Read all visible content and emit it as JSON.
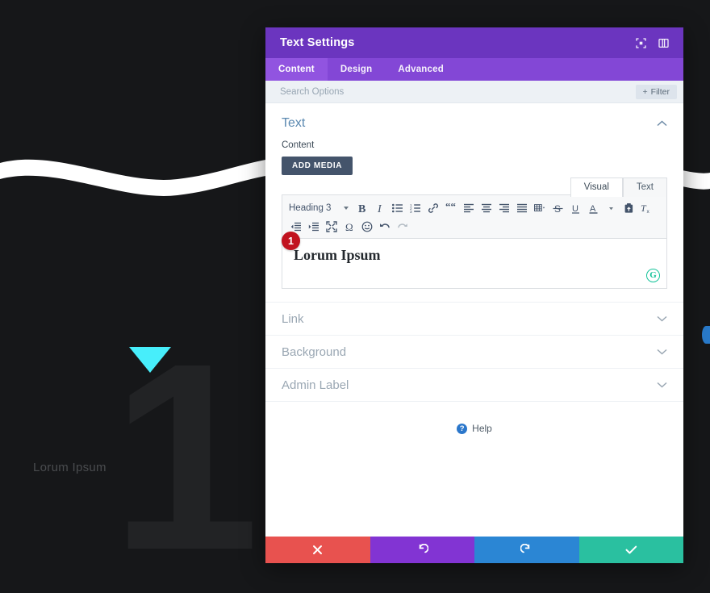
{
  "app": {
    "background": {
      "hero_number": "1",
      "hero_label": "Lorum Ipsum",
      "accent_color": "#47eefb",
      "page_bg": "#161719",
      "divider_color": "#ffffff"
    }
  },
  "panel": {
    "title": "Text Settings",
    "header_color": "#6b35bf",
    "tabbar_color": "#8347d6",
    "header_icons": [
      {
        "name": "expand-icon"
      },
      {
        "name": "panel-layout-icon"
      }
    ],
    "tabs": [
      {
        "label": "Content",
        "active": true
      },
      {
        "label": "Design",
        "active": false
      },
      {
        "label": "Advanced",
        "active": false
      }
    ],
    "search": {
      "value": "",
      "placeholder": "Search Options"
    },
    "filter_button": {
      "label": "Filter",
      "plus": "+"
    },
    "sections": [
      {
        "label": "Text",
        "open": true
      },
      {
        "label": "Link",
        "open": false
      },
      {
        "label": "Background",
        "open": false
      },
      {
        "label": "Admin Label",
        "open": false
      }
    ],
    "text_section": {
      "field_label": "Content",
      "add_media_label": "ADD MEDIA",
      "editor_tabs": [
        {
          "label": "Visual",
          "active": true
        },
        {
          "label": "Text",
          "active": false
        }
      ],
      "format_select": "Heading 3",
      "toolbar_row1": [
        "bold-icon",
        "italic-icon",
        "bulleted-list-icon",
        "numbered-list-icon",
        "link-icon",
        "blockquote-icon",
        "align-left-icon",
        "align-center-icon",
        "align-right-icon",
        "align-justify-icon",
        "table-icon",
        "strikethrough-icon",
        "underline-icon",
        "text-color-icon",
        "paste-as-text-icon",
        "clear-formatting-icon"
      ],
      "toolbar_row2": [
        "outdent-icon",
        "indent-icon",
        "fullscreen-icon",
        "special-character-icon",
        "emoji-icon",
        "undo-icon",
        "redo-icon"
      ],
      "content_html": "Lorum Ipsum",
      "grammar_badge": "G",
      "step_badge": "1"
    },
    "help": {
      "label": "Help",
      "icon_glyph": "?"
    },
    "footer_buttons": [
      {
        "name": "cancel-button",
        "icon": "close-icon",
        "color": "#e8524f"
      },
      {
        "name": "undo-button",
        "icon": "undo-icon",
        "color": "#8234d3"
      },
      {
        "name": "redo-button",
        "icon": "redo-icon",
        "color": "#2b86d4"
      },
      {
        "name": "save-button",
        "icon": "check-icon",
        "color": "#2ac0a0"
      }
    ]
  }
}
